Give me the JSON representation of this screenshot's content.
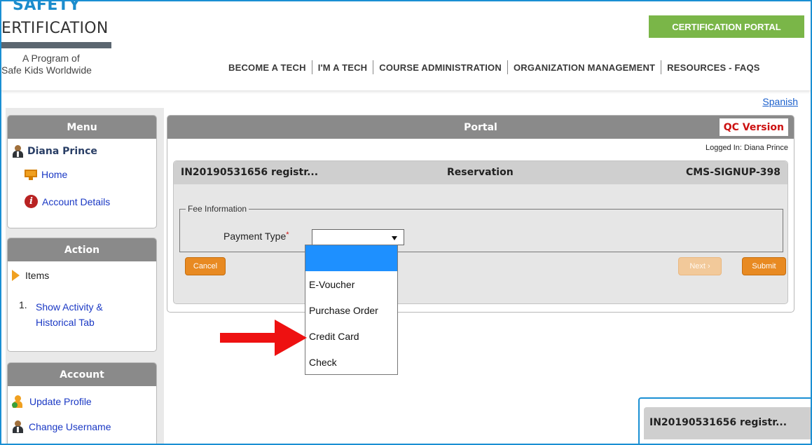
{
  "header": {
    "logo_top": "SAFETY",
    "logo_main": "ERTIFICATION",
    "program_line1": "A Program of",
    "program_line2": "Safe Kids Worldwide",
    "cert_button": "CERTIFICATION PORTAL",
    "nav": [
      "BECOME A TECH",
      "I'M A TECH",
      "COURSE ADMINISTRATION",
      "ORGANIZATION MANAGEMENT",
      "RESOURCES - FAQS"
    ],
    "spanish_link": "Spanish"
  },
  "sidebar": {
    "menu": {
      "title": "Menu",
      "user_name": "Diana Prince",
      "home": "Home",
      "account_details": "Account Details"
    },
    "action": {
      "title": "Action",
      "items_label": "Items",
      "list_number": "1.",
      "list_link": "Show Activity & Historical Tab"
    },
    "account": {
      "title": "Account",
      "update_profile": "Update Profile",
      "change_username": "Change Username"
    }
  },
  "portal": {
    "title": "Portal",
    "qc_badge": "QC Version",
    "logged_in": "Logged In: Diana Prince",
    "inner": {
      "left_title": "IN20190531656 registr...",
      "center_title": "Reservation",
      "right_title": "CMS-SIGNUP-398"
    },
    "fee_legend": "Fee Information",
    "payment_label": "Payment Type",
    "required_mark": "*",
    "payment_selected": "",
    "buttons": {
      "cancel": "Cancel",
      "next": "Next ›",
      "submit": "Submit"
    }
  },
  "dropdown": {
    "options": [
      "",
      "E-Voucher",
      "Purchase Order",
      "Credit Card",
      "Check"
    ]
  },
  "bottom_panel": {
    "title": "IN20190531656 registr..."
  },
  "colors": {
    "brand_blue": "#1b8ccc",
    "cert_green": "#7ab648",
    "panel_gray": "#8a8a8a",
    "button_orange": "#e88a22",
    "qc_red": "#cc1111",
    "selected_option": "#1e90ff",
    "annotation_arrow": "#ee1111"
  },
  "icons": {
    "user": "person-icon",
    "home": "monitor-icon",
    "account_details": "info-icon",
    "items": "triangle-right-icon",
    "update_profile": "person-check-icon",
    "change_username": "person-icon",
    "annotation": "red-arrow-icon"
  }
}
